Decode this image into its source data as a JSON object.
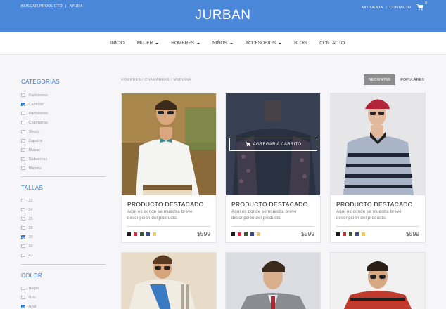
{
  "header": {
    "left_links": [
      "BUSCAR PRODUCTO",
      "AYUDA"
    ],
    "logo": "JURBAN",
    "right_links": [
      "MI CUENTA",
      "CONTACTO"
    ],
    "cart_count": "0",
    "bg_color": "#4a87d9"
  },
  "nav": {
    "items": [
      {
        "label": "INICIO",
        "dropdown": false
      },
      {
        "label": "MUJER",
        "dropdown": true
      },
      {
        "label": "HOMBRES",
        "dropdown": true
      },
      {
        "label": "NIÑOS",
        "dropdown": true
      },
      {
        "label": "ACCESORIOS",
        "dropdown": true
      },
      {
        "label": "BLOG",
        "dropdown": false
      },
      {
        "label": "CONTACTO",
        "dropdown": false
      }
    ]
  },
  "sidebar": {
    "categorias": {
      "title": "CATEGORÍAS",
      "items": [
        {
          "label": "Pantalones",
          "checked": false
        },
        {
          "label": "Camisas",
          "checked": true
        },
        {
          "label": "Pantalones",
          "checked": false
        },
        {
          "label": "Chamarras",
          "checked": false
        },
        {
          "label": "Shorts",
          "checked": false
        },
        {
          "label": "Zapatos",
          "checked": false
        },
        {
          "label": "Blusas",
          "checked": false
        },
        {
          "label": "Sudaderas",
          "checked": false
        },
        {
          "label": "Blazers",
          "checked": false
        }
      ]
    },
    "tallas": {
      "title": "TALLAS",
      "items": [
        {
          "label": "22",
          "checked": false
        },
        {
          "label": "24",
          "checked": false
        },
        {
          "label": "26",
          "checked": false
        },
        {
          "label": "28",
          "checked": false
        },
        {
          "label": "30",
          "checked": true
        },
        {
          "label": "32",
          "checked": false
        },
        {
          "label": "43",
          "checked": false
        }
      ]
    },
    "color": {
      "title": "COLOR",
      "items": [
        {
          "label": "Negro",
          "checked": false
        },
        {
          "label": "Gris",
          "checked": false
        },
        {
          "label": "Azul",
          "checked": true
        }
      ]
    }
  },
  "breadcrumb": "HOMBRES / CHAMARRAS / MEDIANA",
  "sort": {
    "active": "RECIENTES",
    "inactive": "POPULARES"
  },
  "products": [
    {
      "title": "PRODUCTO DESTACADO",
      "desc": "Aquí es donde se muestra breve descripción del producto.",
      "price": "$599",
      "hover": false
    },
    {
      "title": "PRODUCTO DESTACADO",
      "desc": "Aquí es donde se muestra breve descripción del producto.",
      "price": "$599",
      "hover": true,
      "cta": "AGREGAR A CARRITO"
    },
    {
      "title": "PRODUCTO DESTACADO",
      "desc": "Aquí es donde se muestra breve descripción del producto.",
      "price": "$599",
      "hover": false
    }
  ],
  "swatch_colors": [
    "#1a1a1a",
    "#d22b3b",
    "#3c5a2b",
    "#3b4a8c",
    "#f3c85a"
  ]
}
